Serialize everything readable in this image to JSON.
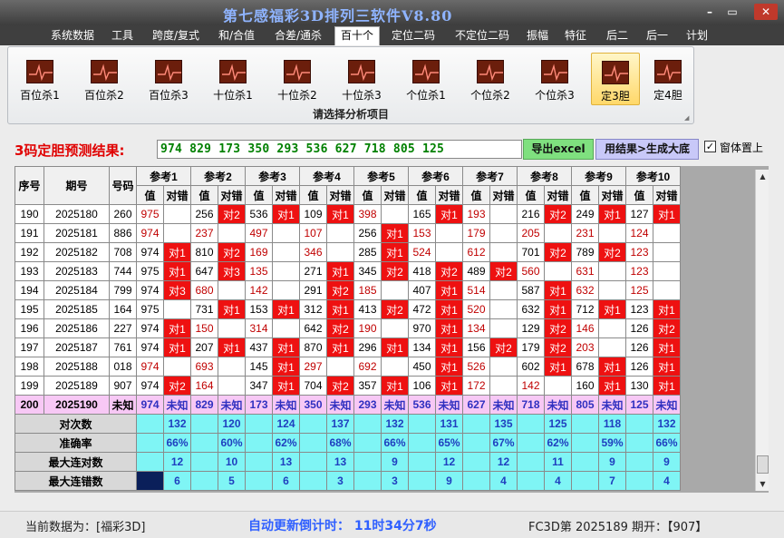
{
  "window": {
    "title": "第七感福彩3D排列三软件V8.80",
    "controls": {
      "minimize": "–",
      "restore": "▭",
      "close": "✕"
    }
  },
  "menu": [
    "系统数据",
    "工具",
    "跨度/复式",
    "和/合值",
    "合差/通杀",
    "百十个",
    "定位二码",
    "不定位二码",
    "振幅",
    "特征",
    "后二",
    "后一",
    "计划"
  ],
  "menu_active": "百十个",
  "ribbon": {
    "buttons": [
      "百位杀1",
      "百位杀2",
      "百位杀3",
      "十位杀1",
      "十位杀2",
      "十位杀3",
      "个位杀1",
      "个位杀2",
      "个位杀3",
      "定3胆",
      "定4胆"
    ],
    "selected": "定3胆",
    "caption": "请选择分析项目"
  },
  "prediction": {
    "label": "3码定胆预测结果:",
    "value": "974 829 173 350 293 536 627 718 805 125",
    "export_button": "导出excel",
    "generate_button": "用结果>生成大底",
    "checkbox_label": "窗体置上",
    "checkbox_checked": true
  },
  "table": {
    "headers": {
      "seq": "序号",
      "period": "期号",
      "number": "号码",
      "value": "值",
      "result": "对错"
    },
    "refs": [
      "参考1",
      "参考2",
      "参考3",
      "参考4",
      "参考5",
      "参考6",
      "参考7",
      "参考8",
      "参考9",
      "参考10"
    ],
    "rows": [
      {
        "seq": "190",
        "period": "2025180",
        "number": "260",
        "cells": [
          [
            "975",
            "r",
            ""
          ],
          [
            "256",
            "b",
            "对2"
          ],
          [
            "536",
            "b",
            "对1"
          ],
          [
            "109",
            "b",
            "对1"
          ],
          [
            "398",
            "r",
            ""
          ],
          [
            "165",
            "b",
            "对1"
          ],
          [
            "193",
            "r",
            ""
          ],
          [
            "216",
            "b",
            "对2"
          ],
          [
            "249",
            "b",
            "对1"
          ],
          [
            "127",
            "b",
            "对1"
          ]
        ]
      },
      {
        "seq": "191",
        "period": "2025181",
        "number": "886",
        "cells": [
          [
            "974",
            "r",
            ""
          ],
          [
            "237",
            "r",
            ""
          ],
          [
            "497",
            "r",
            ""
          ],
          [
            "107",
            "r",
            ""
          ],
          [
            "256",
            "b",
            "对1"
          ],
          [
            "153",
            "r",
            ""
          ],
          [
            "179",
            "r",
            ""
          ],
          [
            "205",
            "r",
            ""
          ],
          [
            "231",
            "r",
            ""
          ],
          [
            "124",
            "r",
            ""
          ]
        ]
      },
      {
        "seq": "192",
        "period": "2025182",
        "number": "708",
        "cells": [
          [
            "974",
            "b",
            "对1"
          ],
          [
            "810",
            "b",
            "对2"
          ],
          [
            "169",
            "r",
            ""
          ],
          [
            "346",
            "r",
            ""
          ],
          [
            "285",
            "b",
            "对1"
          ],
          [
            "524",
            "r",
            ""
          ],
          [
            "612",
            "r",
            ""
          ],
          [
            "701",
            "b",
            "对2"
          ],
          [
            "789",
            "b",
            "对2"
          ],
          [
            "123",
            "r",
            ""
          ]
        ]
      },
      {
        "seq": "193",
        "period": "2025183",
        "number": "744",
        "cells": [
          [
            "975",
            "b",
            "对1"
          ],
          [
            "647",
            "b",
            "对3"
          ],
          [
            "135",
            "r",
            ""
          ],
          [
            "271",
            "b",
            "对1"
          ],
          [
            "345",
            "b",
            "对2"
          ],
          [
            "418",
            "b",
            "对2"
          ],
          [
            "489",
            "b",
            "对2"
          ],
          [
            "560",
            "r",
            ""
          ],
          [
            "631",
            "r",
            ""
          ],
          [
            "123",
            "r",
            ""
          ]
        ]
      },
      {
        "seq": "194",
        "period": "2025184",
        "number": "799",
        "cells": [
          [
            "974",
            "b",
            "对3"
          ],
          [
            "680",
            "r",
            ""
          ],
          [
            "142",
            "r",
            ""
          ],
          [
            "291",
            "b",
            "对2"
          ],
          [
            "185",
            "r",
            ""
          ],
          [
            "407",
            "b",
            "对1"
          ],
          [
            "514",
            "r",
            ""
          ],
          [
            "587",
            "b",
            "对1"
          ],
          [
            "632",
            "r",
            ""
          ],
          [
            "125",
            "r",
            ""
          ]
        ]
      },
      {
        "seq": "195",
        "period": "2025185",
        "number": "164",
        "cells": [
          [
            "975",
            "b",
            ""
          ],
          [
            "731",
            "b",
            "对1"
          ],
          [
            "153",
            "b",
            "对1"
          ],
          [
            "312",
            "b",
            "对1"
          ],
          [
            "413",
            "b",
            "对2"
          ],
          [
            "472",
            "b",
            "对1"
          ],
          [
            "520",
            "r",
            ""
          ],
          [
            "632",
            "b",
            "对1"
          ],
          [
            "712",
            "b",
            "对1"
          ],
          [
            "123",
            "b",
            "对1"
          ]
        ]
      },
      {
        "seq": "196",
        "period": "2025186",
        "number": "227",
        "cells": [
          [
            "974",
            "b",
            "对1"
          ],
          [
            "150",
            "r",
            ""
          ],
          [
            "314",
            "r",
            ""
          ],
          [
            "642",
            "b",
            "对2"
          ],
          [
            "190",
            "r",
            ""
          ],
          [
            "970",
            "b",
            "对1"
          ],
          [
            "134",
            "r",
            ""
          ],
          [
            "129",
            "b",
            "对2"
          ],
          [
            "146",
            "r",
            ""
          ],
          [
            "126",
            "b",
            "对2"
          ]
        ]
      },
      {
        "seq": "197",
        "period": "2025187",
        "number": "761",
        "cells": [
          [
            "974",
            "b",
            "对1"
          ],
          [
            "207",
            "b",
            "对1"
          ],
          [
            "437",
            "b",
            "对1"
          ],
          [
            "870",
            "b",
            "对1"
          ],
          [
            "296",
            "b",
            "对1"
          ],
          [
            "134",
            "b",
            "对1"
          ],
          [
            "156",
            "b",
            "对2"
          ],
          [
            "179",
            "b",
            "对2"
          ],
          [
            "203",
            "r",
            ""
          ],
          [
            "126",
            "b",
            "对1"
          ]
        ]
      },
      {
        "seq": "198",
        "period": "2025188",
        "number": "018",
        "cells": [
          [
            "974",
            "r",
            ""
          ],
          [
            "693",
            "r",
            ""
          ],
          [
            "145",
            "b",
            "对1"
          ],
          [
            "297",
            "r",
            ""
          ],
          [
            "692",
            "r",
            ""
          ],
          [
            "450",
            "b",
            "对1"
          ],
          [
            "526",
            "r",
            ""
          ],
          [
            "602",
            "b",
            "对1"
          ],
          [
            "678",
            "b",
            "对1"
          ],
          [
            "126",
            "b",
            "对1"
          ]
        ]
      },
      {
        "seq": "199",
        "period": "2025189",
        "number": "907",
        "cells": [
          [
            "974",
            "b",
            "对2"
          ],
          [
            "164",
            "r",
            ""
          ],
          [
            "347",
            "b",
            "对1"
          ],
          [
            "704",
            "b",
            "对2"
          ],
          [
            "357",
            "b",
            "对1"
          ],
          [
            "106",
            "b",
            "对1"
          ],
          [
            "172",
            "r",
            ""
          ],
          [
            "142",
            "r",
            ""
          ],
          [
            "160",
            "b",
            "对1"
          ],
          [
            "130",
            "b",
            "对1"
          ]
        ]
      }
    ],
    "predict_row": {
      "seq": "200",
      "period": "2025190",
      "number": "未知",
      "values": [
        "974",
        "829",
        "173",
        "350",
        "293",
        "536",
        "627",
        "718",
        "805",
        "125"
      ],
      "unknown": "未知"
    },
    "stats": [
      {
        "label": "对次数",
        "values": [
          "132",
          "120",
          "124",
          "137",
          "132",
          "131",
          "135",
          "125",
          "118",
          "132"
        ]
      },
      {
        "label": "准确率",
        "values": [
          "66%",
          "60%",
          "62%",
          "68%",
          "66%",
          "65%",
          "67%",
          "62%",
          "59%",
          "66%"
        ]
      },
      {
        "label": "最大连对数",
        "values": [
          "12",
          "10",
          "13",
          "13",
          "9",
          "12",
          "12",
          "11",
          "9",
          "9"
        ]
      },
      {
        "label": "最大连错数",
        "values": [
          "6",
          "5",
          "6",
          "3",
          "3",
          "9",
          "4",
          "4",
          "7",
          "4"
        ]
      }
    ]
  },
  "statusbar": {
    "left": "当前数据为：[福彩3D]",
    "middle": "自动更新倒计时：  11时34分7秒",
    "right": "FC3D第 2025189 期开：【907】"
  },
  "colors": {
    "hit": "#ee1111",
    "predict_row": "#f7c8f5",
    "stats": "#7ff5f5",
    "miss_text": "#c00000"
  }
}
